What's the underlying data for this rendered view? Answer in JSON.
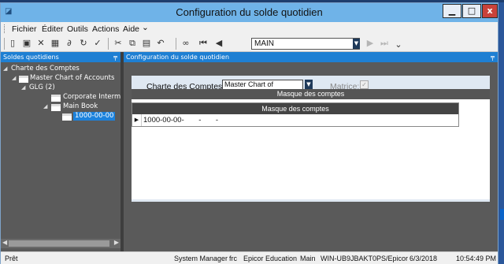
{
  "window": {
    "title": "Configuration du solde quotidien",
    "min_glyph": "▁",
    "max_glyph": "□",
    "close_glyph": "x"
  },
  "menu": {
    "items": [
      "Fichier",
      "Éditer",
      "Outils",
      "Actions",
      "Aide"
    ]
  },
  "toolbar": {
    "combo_value": "MAIN",
    "icons": [
      "new-icon",
      "save-icon",
      "delete-icon",
      "print-icon",
      "attach-icon",
      "refresh-icon",
      "clear-icon",
      "cut-icon",
      "copy-icon",
      "paste-icon",
      "undo-icon",
      "binoculars-icon",
      "first-icon",
      "prev-icon",
      "next-icon",
      "last-icon"
    ]
  },
  "left_panel": {
    "title": "Soldes quotidiens",
    "tree": [
      {
        "label": "Charte des Comptes"
      },
      {
        "label": "Master Chart of Accounts"
      },
      {
        "label": "GLG (2)"
      },
      {
        "label": "Corporate Interm"
      },
      {
        "label": "Main Book"
      },
      {
        "label": "1000-00-00"
      }
    ]
  },
  "right_panel": {
    "title": "Configuration du solde quotidien",
    "charte_label": "Charte des Comptes:",
    "charte_value": "Master Chart of Accounts",
    "matrice_label": "Matrice:",
    "grid_header_outer": "Masque des comptes",
    "grid_header_inner": "Masque des comptes",
    "row_value": "1000-00-00-       -       -"
  },
  "status": {
    "ready": "Prêt",
    "user": "System Manager",
    "lang": "frc",
    "company": "Epicor Education",
    "plant": "Main",
    "server": "WIN-UB9JBAKT0PS/Epicor",
    "date": "6/3/2018",
    "time": "10:54:49 PM"
  }
}
